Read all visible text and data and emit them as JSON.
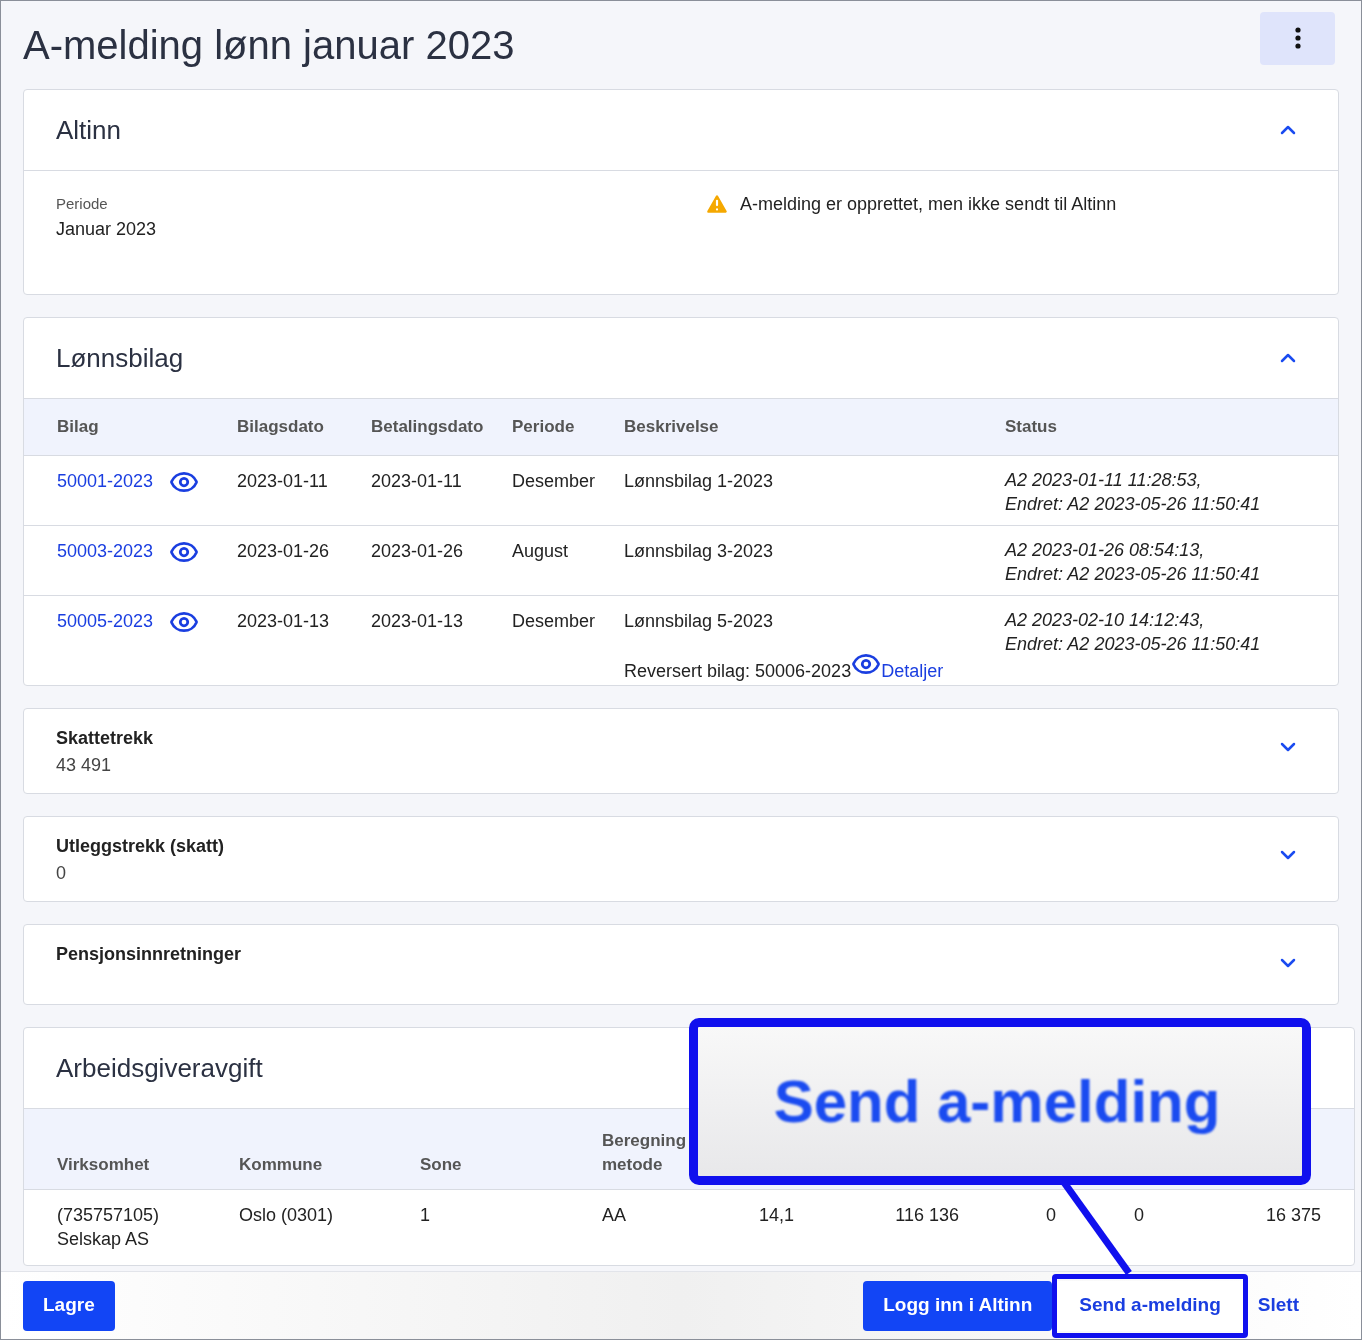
{
  "title": "A-melding lønn januar 2023",
  "altinn": {
    "heading": "Altinn",
    "expanded": true,
    "period_label": "Periode",
    "period_value": "Januar 2023",
    "warning": "A-melding er opprettet, men ikke sendt til Altinn"
  },
  "lonnsbilag": {
    "heading": "Lønnsbilag",
    "expanded": true,
    "columns": [
      "Bilag",
      "Bilagsdato",
      "Betalingsdato",
      "Periode",
      "Beskrivelse",
      "Status"
    ],
    "rows": [
      {
        "bilag": "50001-2023",
        "bilagsdato": "2023-01-11",
        "betalingsdato": "2023-01-11",
        "periode": "Desember",
        "beskrivelse": "Lønnsbilag 1-2023",
        "status": [
          "A2 2023-01-11 11:28:53,",
          "Endret: A2 2023-05-26 11:50:41"
        ]
      },
      {
        "bilag": "50003-2023",
        "bilagsdato": "2023-01-26",
        "betalingsdato": "2023-01-26",
        "periode": "August",
        "beskrivelse": "Lønnsbilag 3-2023",
        "status": [
          "A2 2023-01-26 08:54:13,",
          "Endret: A2 2023-05-26 11:50:41"
        ]
      },
      {
        "bilag": "50005-2023",
        "bilagsdato": "2023-01-13",
        "betalingsdato": "2023-01-13",
        "periode": "Desember",
        "beskrivelse": "Lønnsbilag 5-2023",
        "reversed": "Reversert bilag: 50006-2023",
        "details_link": "Detaljer",
        "status": [
          "A2 2023-02-10 14:12:43,",
          "Endret: A2 2023-05-26 11:50:41"
        ]
      }
    ]
  },
  "summaries": [
    {
      "heading": "Skattetrekk",
      "value": "43 491",
      "expanded": false
    },
    {
      "heading": "Utleggstrekk (skatt)",
      "value": "0",
      "expanded": false
    },
    {
      "heading": "Pensjonsinnretninger",
      "expanded": false
    }
  ],
  "arbeidsgiveravgift": {
    "heading": "Arbeidsgiveravgift",
    "columns": [
      "Virksomhet",
      "Kommune",
      "Sone",
      [
        "Beregning",
        "metode"
      ]
    ],
    "rows": [
      {
        "cells": [
          [
            "(735757105)",
            "Selskap AS"
          ],
          [
            "Oslo (0301)"
          ],
          [
            "1"
          ],
          [
            "AA"
          ],
          [
            "14,1"
          ],
          [
            "116 136"
          ],
          [
            "0"
          ],
          [
            "0"
          ],
          [
            "16 375"
          ]
        ]
      }
    ]
  },
  "footer": {
    "buttons": [
      {
        "label": "Lagre",
        "kind": "primary"
      },
      {
        "label": "Logg inn i Altinn",
        "kind": "primary"
      },
      {
        "label": "Send a-melding",
        "kind": "secondary",
        "highlighted": true
      },
      {
        "label": "Slett",
        "kind": "link"
      }
    ]
  },
  "callout": {
    "text": "Send a-melding"
  }
}
